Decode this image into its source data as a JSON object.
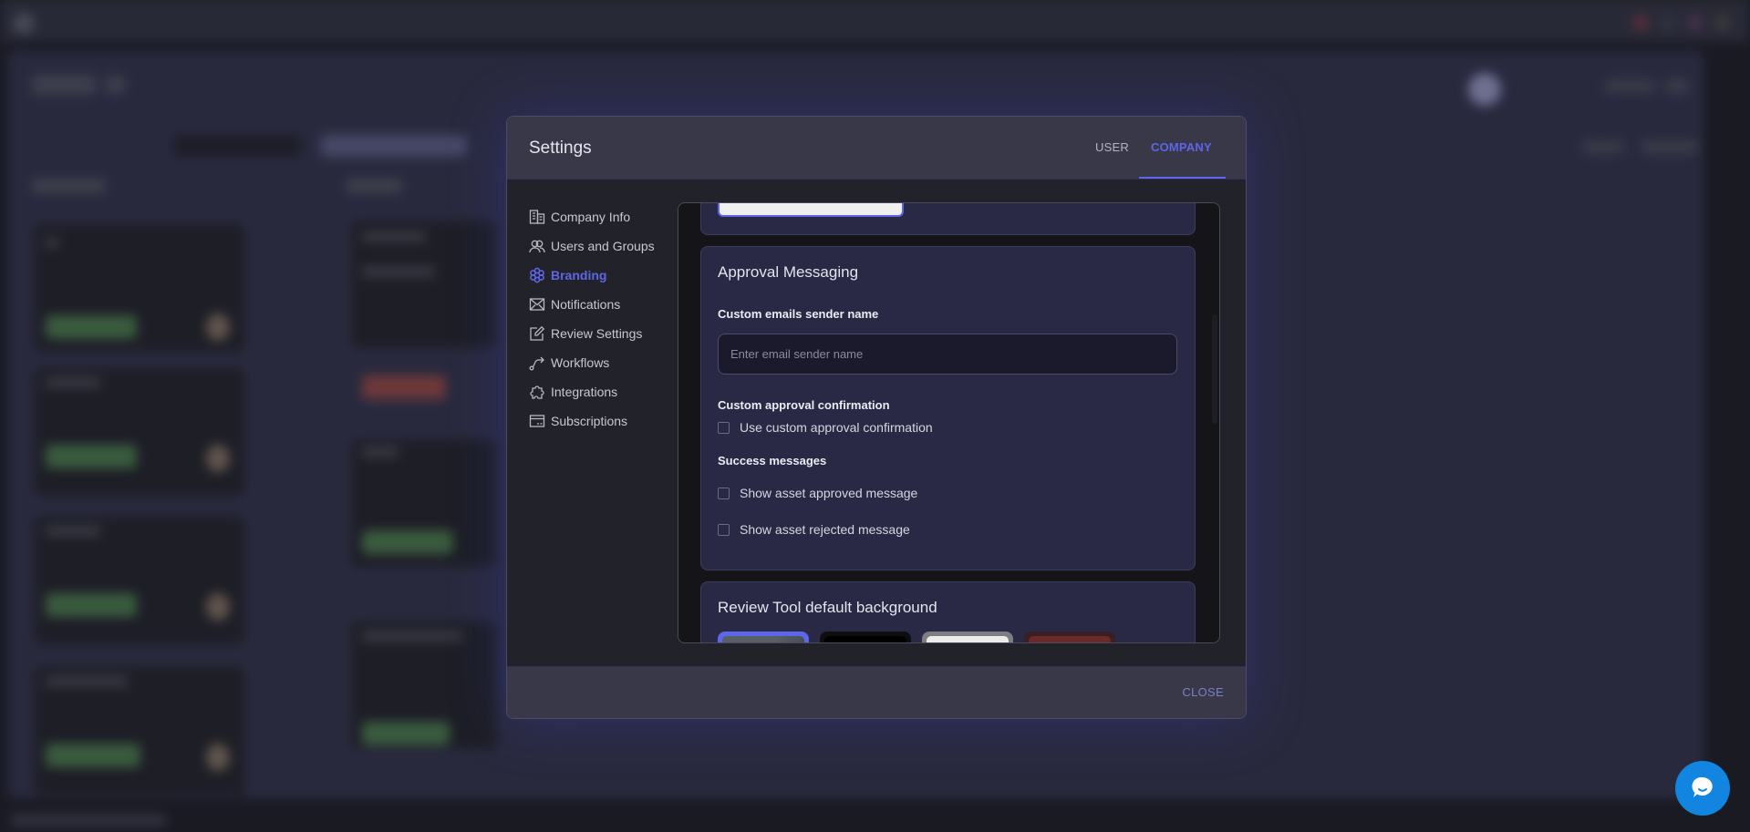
{
  "modal": {
    "title": "Settings",
    "tabs": [
      {
        "label": "USER",
        "active": false
      },
      {
        "label": "COMPANY",
        "active": true
      }
    ],
    "accent_color": "#5b66e8",
    "sidebar": {
      "items": [
        {
          "label": "Company Info",
          "icon": "building-icon",
          "active": false
        },
        {
          "label": "Users and Groups",
          "icon": "users-icon",
          "active": false
        },
        {
          "label": "Branding",
          "icon": "flower-icon",
          "active": true
        },
        {
          "label": "Notifications",
          "icon": "envelope-icon",
          "active": false
        },
        {
          "label": "Review Settings",
          "icon": "edit-icon",
          "active": false
        },
        {
          "label": "Workflows",
          "icon": "workflow-icon",
          "active": false
        },
        {
          "label": "Integrations",
          "icon": "puzzle-icon",
          "active": false
        },
        {
          "label": "Subscriptions",
          "icon": "card-icon",
          "active": false
        }
      ]
    },
    "approval_messaging": {
      "title": "Approval Messaging",
      "sender_name_label": "Custom emails sender name",
      "sender_name_value": "",
      "sender_name_placeholder": "Enter email sender name",
      "confirmation_label": "Custom approval confirmation",
      "confirmation_checkbox": {
        "label": "Use custom approval confirmation",
        "checked": false
      },
      "success_label": "Success messages",
      "success_checkboxes": [
        {
          "label": "Show asset approved message",
          "checked": false
        },
        {
          "label": "Show asset rejected message",
          "checked": false
        }
      ]
    },
    "review_background": {
      "title": "Review Tool default background",
      "swatches": [
        {
          "name": "gradient-gray",
          "color": "#5a5e66",
          "selected": true
        },
        {
          "name": "black",
          "color": "#000000",
          "selected": false
        },
        {
          "name": "white",
          "color": "#ececec",
          "selected": false
        },
        {
          "name": "dark-red",
          "color": "#6a2a2a",
          "selected": false
        }
      ]
    },
    "footer": {
      "close_label": "CLOSE"
    }
  },
  "chat_widget": {
    "icon": "chat-bubble-icon",
    "color": "#1185e0"
  }
}
